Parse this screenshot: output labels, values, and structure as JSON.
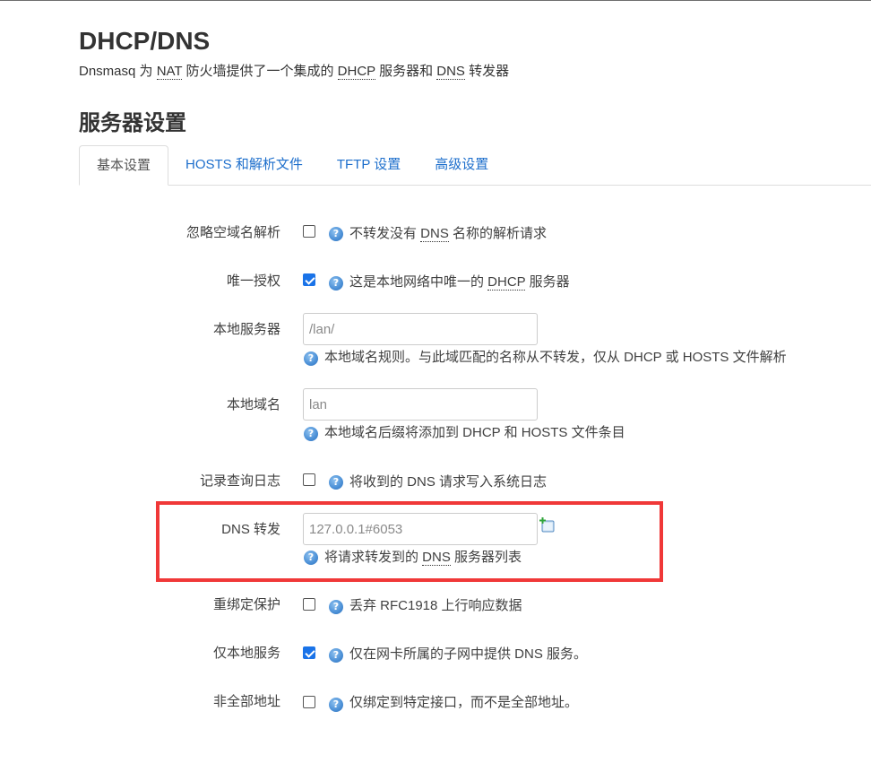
{
  "header": {
    "title": "DHCP/DNS",
    "description_parts": [
      "Dnsmasq 为 ",
      "NAT",
      " 防火墙提供了一个集成的 ",
      "DHCP",
      " 服务器和 ",
      "DNS",
      " 转发器"
    ]
  },
  "section": {
    "title": "服务器设置"
  },
  "tabs": [
    {
      "label": "基本设置",
      "active": true
    },
    {
      "label": "HOSTS 和解析文件",
      "active": false
    },
    {
      "label": "TFTP 设置",
      "active": false
    },
    {
      "label": "高级设置",
      "active": false
    }
  ],
  "fields": {
    "ignore_empty": {
      "label": "忽略空域名解析",
      "checked": false,
      "help_parts": [
        "不转发没有 ",
        "DNS",
        " 名称的解析请求"
      ]
    },
    "authoritative": {
      "label": "唯一授权",
      "checked": true,
      "help_parts": [
        "这是本地网络中唯一的 ",
        "DHCP",
        " 服务器"
      ]
    },
    "local_server": {
      "label": "本地服务器",
      "placeholder": "/lan/",
      "help": "本地域名规则。与此域匹配的名称从不转发，仅从 DHCP 或 HOSTS 文件解析"
    },
    "local_domain": {
      "label": "本地域名",
      "placeholder": "lan",
      "help": "本地域名后缀将添加到 DHCP 和 HOSTS 文件条目"
    },
    "log_queries": {
      "label": "记录查询日志",
      "checked": false,
      "help": "将收到的 DNS 请求写入系统日志"
    },
    "dns_forward": {
      "label": "DNS 转发",
      "placeholder": "127.0.0.1#6053",
      "help_parts": [
        "将请求转发到的 ",
        "DNS",
        " 服务器列表"
      ]
    },
    "rebind_protection": {
      "label": "重绑定保护",
      "checked": false,
      "help": "丢弃 RFC1918 上行响应数据"
    },
    "local_service": {
      "label": "仅本地服务",
      "checked": true,
      "help": "仅在网卡所属的子网中提供 DNS 服务。"
    },
    "nonwildcard": {
      "label": "非全部地址",
      "checked": false,
      "help": "仅绑定到特定接口，而不是全部地址。"
    }
  },
  "icons": {
    "help": "help-question-icon",
    "add": "add-entry-icon"
  },
  "colors": {
    "link": "#1e6fcc",
    "checkbox_checked": "#1a73e8",
    "highlight": "#f03838"
  }
}
